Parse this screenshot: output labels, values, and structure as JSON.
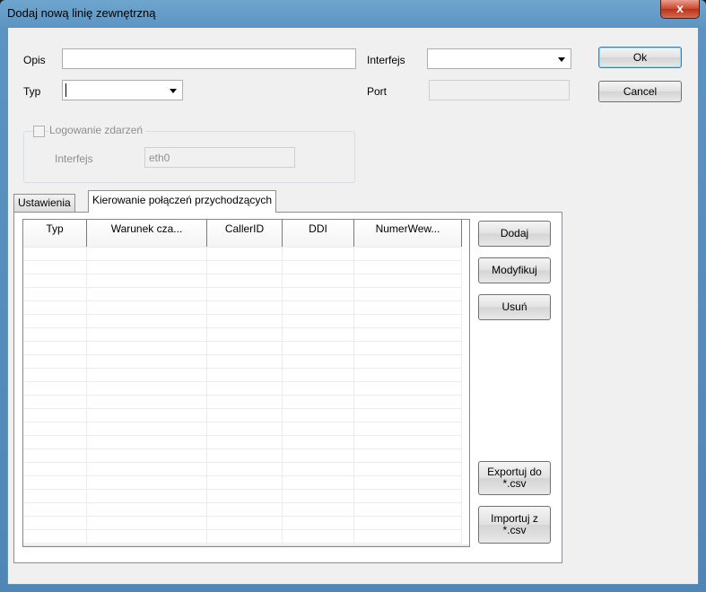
{
  "window": {
    "title": "Dodaj nową linię zewnętrzną",
    "close_glyph": "x"
  },
  "form": {
    "opis_label": "Opis",
    "opis_value": "",
    "typ_label": "Typ",
    "typ_value": "",
    "interfejs_label": "Interfejs",
    "interfejs_value": "",
    "port_label": "Port",
    "port_value": ""
  },
  "buttons": {
    "ok": "Ok",
    "cancel": "Cancel"
  },
  "logging_group": {
    "checkbox_label": "Logowanie zdarzeń",
    "interfejs_label": "Interfejs",
    "interfejs_value": "eth0"
  },
  "tabs": [
    {
      "label": "Ustawienia",
      "active": false
    },
    {
      "label": "Kierowanie połączeń przychodzących",
      "active": true
    }
  ],
  "table": {
    "columns": [
      "Typ",
      "Warunek cza...",
      "CallerID",
      "DDI",
      "NumerWew..."
    ],
    "rows": []
  },
  "side_buttons": {
    "add": "Dodaj",
    "modify": "Modyfikuj",
    "delete": "Usuń",
    "export": "Exportuj do *.csv",
    "import": "Importuj z *.csv"
  },
  "icons": {
    "close": "close-icon",
    "dropdown": "chevron-down-icon"
  },
  "colors": {
    "titlebar": "#5b93c2",
    "close_button": "#c9462c",
    "client_bg": "#f0f0f0"
  }
}
